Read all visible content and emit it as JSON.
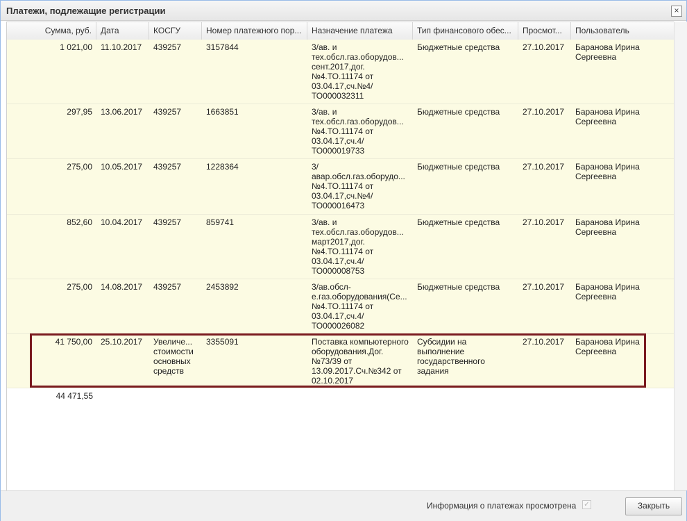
{
  "dialog": {
    "title": "Платежи, подлежащие регистрации",
    "close_icon": "×"
  },
  "table": {
    "columns": [
      "Сумма, руб.",
      "Дата",
      "КОСГУ",
      "Номер платежного пор...",
      "Назначение платежа",
      "Тип финансового обес...",
      "Просмот...",
      "Пользователь"
    ],
    "rows": [
      {
        "amount": "1 021,00",
        "date": "11.10.2017",
        "kosgu": "439257",
        "number": "3157844",
        "purpose": "3/ав. и тех.обсл.газ.оборудов... сент.2017,дог. №4.ТО.11174 от 03.04.17,сч.№4/ ТО000032311",
        "fin_type": "Бюджетные средства",
        "viewed": "27.10.2017",
        "user": "Баранова Ирина Сергеевна"
      },
      {
        "amount": "297,95",
        "date": "13.06.2017",
        "kosgu": "439257",
        "number": "1663851",
        "purpose": "3/ав. и тех.обсл.газ.оборудов... №4.ТО.11174 от 03.04.17,сч.4/ ТО000019733",
        "fin_type": "Бюджетные средства",
        "viewed": "27.10.2017",
        "user": "Баранова Ирина Сергеевна"
      },
      {
        "amount": "275,00",
        "date": "10.05.2017",
        "kosgu": "439257",
        "number": "1228364",
        "purpose": "3/ авар.обсл.газ.оборудо... №4.ТО.11174 от 03.04.17,сч.№4/ ТО000016473",
        "fin_type": "Бюджетные средства",
        "viewed": "27.10.2017",
        "user": "Баранова Ирина Сергеевна"
      },
      {
        "amount": "852,60",
        "date": "10.04.2017",
        "kosgu": "439257",
        "number": "859741",
        "purpose": "3/ав. и тех.обсл.газ.оборудов... март2017,дог. №4.ТО.11174 от 03.04.17,сч.4/ ТО000008753",
        "fin_type": "Бюджетные средства",
        "viewed": "27.10.2017",
        "user": "Баранова Ирина Сергеевна"
      },
      {
        "amount": "275,00",
        "date": "14.08.2017",
        "kosgu": "439257",
        "number": "2453892",
        "purpose": "3/ав.обсл- е.газ.оборудования(Се... №4.ТО.11174 от 03.04.17,сч.4/ ТО000026082",
        "fin_type": "Бюджетные средства",
        "viewed": "27.10.2017",
        "user": "Баранова Ирина Сергеевна"
      },
      {
        "amount": "41 750,00",
        "date": "25.10.2017",
        "kosgu": "Увеличе... стоимости основных средств",
        "number": "3355091",
        "purpose": "Поставка компьютерного оборудования.Дог. №73/39 от 13.09.2017.Сч.№342 от 02.10.2017",
        "fin_type": "Субсидии на выполнение государственного задания",
        "viewed": "27.10.2017",
        "user": "Баранова Ирина Сергеевна"
      }
    ],
    "total": "44 471,55"
  },
  "footer": {
    "viewed_label": "Информация о платежах просмотрена",
    "viewed_checked": true,
    "check_glyph": "✓",
    "close_label": "Закрыть"
  },
  "colors": {
    "row_bg": "#fcfbe3",
    "highlight_border": "#7a1a1f"
  }
}
